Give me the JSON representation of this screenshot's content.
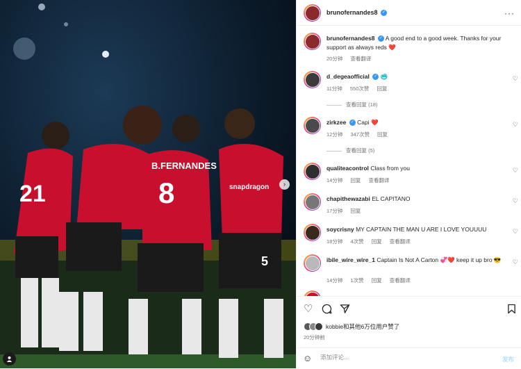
{
  "post": {
    "author": "brunofernandes8",
    "caption": "A good end to a good week. Thanks for your support as always reds",
    "caption_emoji": "❤️",
    "caption_time": "20分钟",
    "see_translation": "查看翻译",
    "more_icon": "···"
  },
  "comments": [
    {
      "user": "d_degeaofficial",
      "verified": true,
      "text": "",
      "emoji": "🥶",
      "time": "11分钟",
      "likes": "550次赞",
      "reply": "回复",
      "translate": "",
      "replies": "查看回复 (18)"
    },
    {
      "user": "zirkzee",
      "verified": true,
      "text": "Capi",
      "emoji": "❤️",
      "time": "12分钟",
      "likes": "347次赞",
      "reply": "回复",
      "translate": "",
      "replies": "查看回复 (5)"
    },
    {
      "user": "qualiteacontrol",
      "verified": false,
      "text": "Class from you",
      "emoji": "",
      "time": "14分钟",
      "likes": "",
      "reply": "回复",
      "translate": "查看翻译",
      "replies": ""
    },
    {
      "user": "chapithewazabi",
      "verified": false,
      "text": "EL CAPITANO",
      "emoji": "",
      "time": "17分钟",
      "likes": "",
      "reply": "回复",
      "translate": "",
      "replies": ""
    },
    {
      "user": "soycrisny",
      "verified": false,
      "text": "MY CAPTAIN THE MAN U ARE I LOVE YOUUUU",
      "emoji": "",
      "time": "18分钟",
      "likes": "4次赞",
      "reply": "回复",
      "translate": "查看翻译",
      "replies": ""
    },
    {
      "user": "ibile_wire_wire_1",
      "verified": false,
      "text": "Captain Is Not A Carton",
      "emoji": "💞❤️ keep it up bro 😎",
      "time": "14分钟",
      "likes": "1次赞",
      "reply": "回复",
      "translate": "查看翻译",
      "replies": ""
    }
  ],
  "actions": {
    "liked_by": "kobbie和其他6万位用户赞了",
    "time": "20分钟前",
    "comment_placeholder": "添加评论...",
    "post_label": "发布",
    "emoji_icon": "☺"
  },
  "colors": {
    "accent": "#3897f0",
    "heart": "#ed4956",
    "post_disabled": "#b2dffc",
    "muted": "#737373"
  },
  "photo": {
    "jersey_name": "B.FERNANDES",
    "jersey_number": "8",
    "sponsor": "snapdragon",
    "shorts_number": "5"
  }
}
